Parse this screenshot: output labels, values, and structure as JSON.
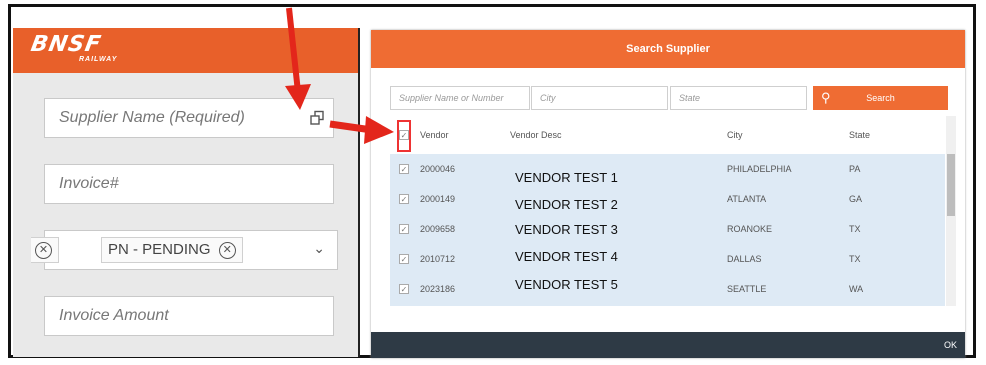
{
  "brand": {
    "logo_text": "BNSF",
    "logo_sub": "RAILWAY"
  },
  "form": {
    "supplier_placeholder": "Supplier Name (Required)",
    "invoice_placeholder": "Invoice#",
    "chips": [
      "PN - PENDING"
    ],
    "amount_placeholder": "Invoice Amount"
  },
  "modal": {
    "title": "Search Supplier",
    "search": {
      "supplier_placeholder": "Supplier Name or Number",
      "city_placeholder": "City",
      "state_placeholder": "State",
      "button_label": "Search"
    },
    "columns": {
      "vendor": "Vendor",
      "vendor_desc": "Vendor Desc",
      "city": "City",
      "state": "State"
    },
    "rows": [
      {
        "vendor": "2000046",
        "desc": "VENDOR TEST 1",
        "city": "PHILADELPHIA",
        "state": "PA"
      },
      {
        "vendor": "2000149",
        "desc": "VENDOR TEST 2",
        "city": "ATLANTA",
        "state": "GA"
      },
      {
        "vendor": "2009658",
        "desc": "VENDOR TEST 3",
        "city": "ROANOKE",
        "state": "TX"
      },
      {
        "vendor": "2010712",
        "desc": "VENDOR TEST 4",
        "city": "DALLAS",
        "state": "TX"
      },
      {
        "vendor": "2023186",
        "desc": "VENDOR TEST 5",
        "city": "SEATTLE",
        "state": "WA"
      }
    ],
    "ok_label": "OK"
  },
  "colors": {
    "brand_orange": "#ef6c33",
    "annotation_red": "#e3261b",
    "row_selected": "#deeaf5",
    "footer": "#2e3a45"
  },
  "icons": {
    "copy": "copy-icon",
    "remove": "close-circle-icon",
    "chevron": "chevron-down-icon",
    "search": "search-icon",
    "check": "checkbox-checked-icon"
  }
}
